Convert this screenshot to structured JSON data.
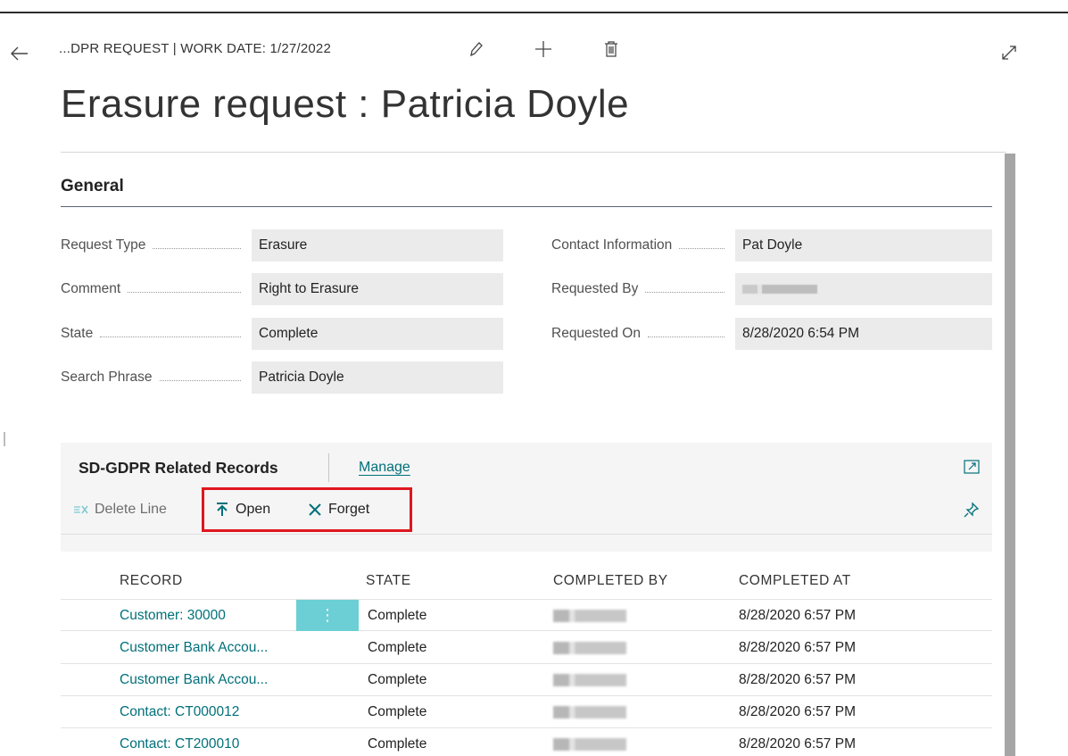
{
  "header": {
    "breadcrumb": "...DPR REQUEST | WORK DATE: 1/27/2022",
    "title": "Erasure request : Patricia Doyle",
    "icons": [
      "back-arrow-icon",
      "edit-pencil-icon",
      "new-plus-icon",
      "delete-trash-icon",
      "expand-icon"
    ]
  },
  "general": {
    "section_title": "General",
    "left_fields": [
      {
        "label": "Request Type",
        "value": "Erasure"
      },
      {
        "label": "Comment",
        "value": "Right to Erasure"
      },
      {
        "label": "State",
        "value": "Complete"
      },
      {
        "label": "Search Phrase",
        "value": "Patricia Doyle"
      }
    ],
    "right_fields": [
      {
        "label": "Contact Information",
        "value": "Pat Doyle"
      },
      {
        "label": "Requested By",
        "value": ""
      },
      {
        "label": "Requested On",
        "value": "8/28/2020 6:54 PM"
      }
    ]
  },
  "related_records": {
    "title": "SD-GDPR Related Records",
    "manage_label": "Manage",
    "actions": {
      "delete_line": "Delete Line",
      "open": "Open",
      "forget": "Forget"
    },
    "columns": [
      "RECORD",
      "STATE",
      "COMPLETED BY",
      "COMPLETED AT"
    ],
    "rows": [
      {
        "record": "Customer: 30000",
        "state": "Complete",
        "completed_at": "8/28/2020 6:57 PM"
      },
      {
        "record": "Customer Bank Accou...",
        "state": "Complete",
        "completed_at": "8/28/2020 6:57 PM"
      },
      {
        "record": "Customer Bank Accou...",
        "state": "Complete",
        "completed_at": "8/28/2020 6:57 PM"
      },
      {
        "record": "Contact: CT000012",
        "state": "Complete",
        "completed_at": "8/28/2020 6:57 PM"
      },
      {
        "record": "Contact: CT200010",
        "state": "Complete",
        "completed_at": "8/28/2020 6:57 PM"
      }
    ]
  },
  "colors": {
    "accent_teal": "#00707a",
    "row_menu": "#6ccfd6",
    "highlight_red": "#e0161e"
  }
}
